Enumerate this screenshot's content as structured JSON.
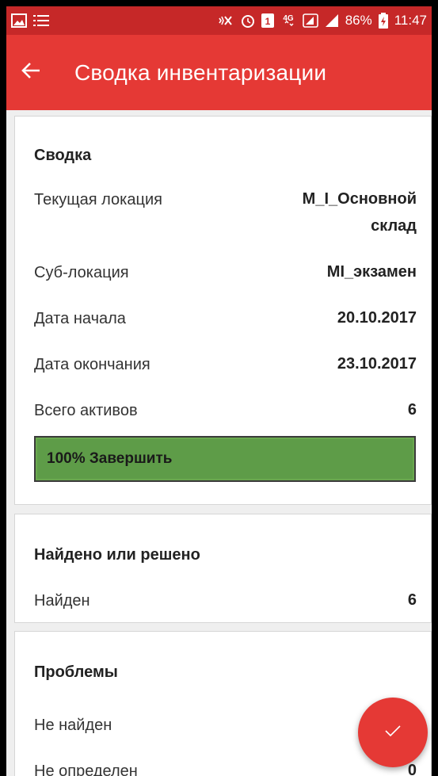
{
  "status_bar": {
    "battery": "86%",
    "time": "11:47",
    "network": "4G",
    "icons": [
      "image-icon",
      "list-icon",
      "vibrate-icon",
      "alarm-icon",
      "notification-badge-icon",
      "4g-icon",
      "sim-icon",
      "signal-icon",
      "battery-charging-icon"
    ]
  },
  "app_bar": {
    "title": "Сводка инвентаризации",
    "back_icon": "arrow-back-icon"
  },
  "summary": {
    "title": "Сводка",
    "rows": [
      {
        "label": "Текущая локация",
        "value_line1": "M_I_Основной",
        "value_line2": "склад"
      },
      {
        "label": "Суб-локация",
        "value": "MI_экзамен"
      },
      {
        "label": "Дата начала",
        "value": "20.10.2017"
      },
      {
        "label": "Дата окончания",
        "value": "23.10.2017"
      },
      {
        "label": "Всего активов",
        "value": "6"
      }
    ],
    "progress": {
      "label": "100% Завершить",
      "percent": 100
    }
  },
  "found": {
    "title": "Найдено или решено",
    "rows": [
      {
        "label": "Найден",
        "value": "6"
      }
    ]
  },
  "problems": {
    "title": "Проблемы",
    "rows": [
      {
        "label": "Не найден",
        "value": ""
      },
      {
        "label": "Не определен",
        "value": "0"
      }
    ]
  },
  "fab": {
    "icon": "check-icon"
  },
  "colors": {
    "status_bar": "#c62828",
    "app_bar": "#e53935",
    "progress": "#6aa84f",
    "fab": "#e53935",
    "background": "#efefef"
  }
}
